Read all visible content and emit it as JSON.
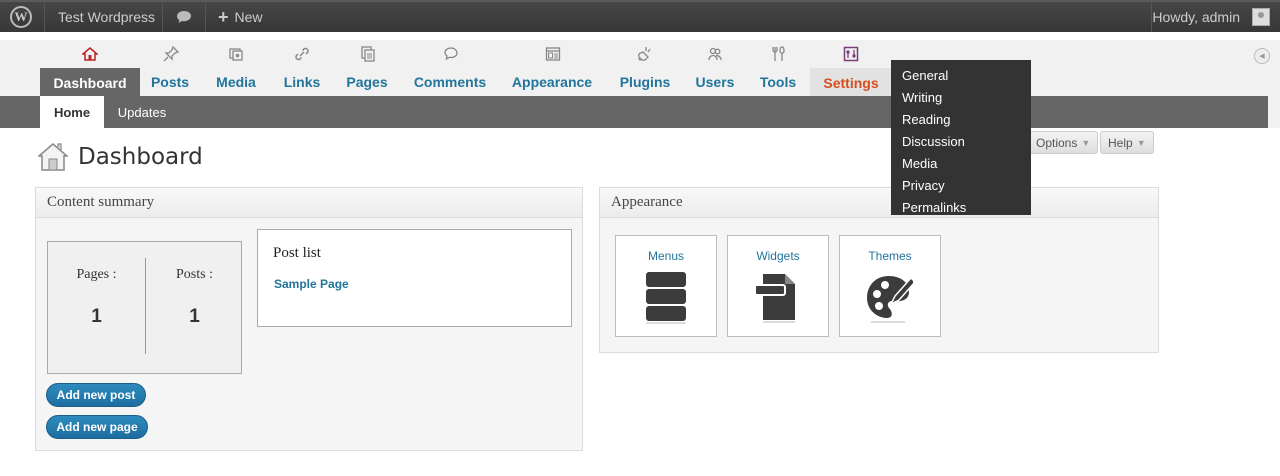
{
  "adminbar": {
    "site_name": "Test Wordpress",
    "new_label": "New",
    "howdy": "Howdy, admin"
  },
  "menu": {
    "items": [
      {
        "label": "Dashboard",
        "icon": "home-icon"
      },
      {
        "label": "Posts",
        "icon": "pin-icon"
      },
      {
        "label": "Media",
        "icon": "media-icon"
      },
      {
        "label": "Links",
        "icon": "link-icon"
      },
      {
        "label": "Pages",
        "icon": "pages-icon"
      },
      {
        "label": "Comments",
        "icon": "comment-icon"
      },
      {
        "label": "Appearance",
        "icon": "appearance-icon"
      },
      {
        "label": "Plugins",
        "icon": "plug-icon"
      },
      {
        "label": "Users",
        "icon": "users-icon"
      },
      {
        "label": "Tools",
        "icon": "tools-icon"
      },
      {
        "label": "Settings",
        "icon": "settings-icon"
      }
    ],
    "subitems": [
      "Home",
      "Updates"
    ]
  },
  "settings_dropdown": [
    "General",
    "Writing",
    "Reading",
    "Discussion",
    "Media",
    "Privacy",
    "Permalinks"
  ],
  "page": {
    "title": "Dashboard",
    "options_label": "Options",
    "help_label": "Help"
  },
  "content_summary": {
    "title": "Content summary",
    "pages_label": "Pages :",
    "pages_value": "1",
    "posts_label": "Posts :",
    "posts_value": "1",
    "post_list_title": "Post list",
    "post_list_item": "Sample Page",
    "add_post": "Add new post",
    "add_page": "Add new page"
  },
  "appearance": {
    "title": "Appearance",
    "tiles": [
      "Menus",
      "Widgets",
      "Themes"
    ]
  },
  "colors": {
    "link": "#21759b",
    "active_menu": "#666666",
    "settings_highlight": "#d54e21",
    "dropdown_bg": "#333333"
  }
}
